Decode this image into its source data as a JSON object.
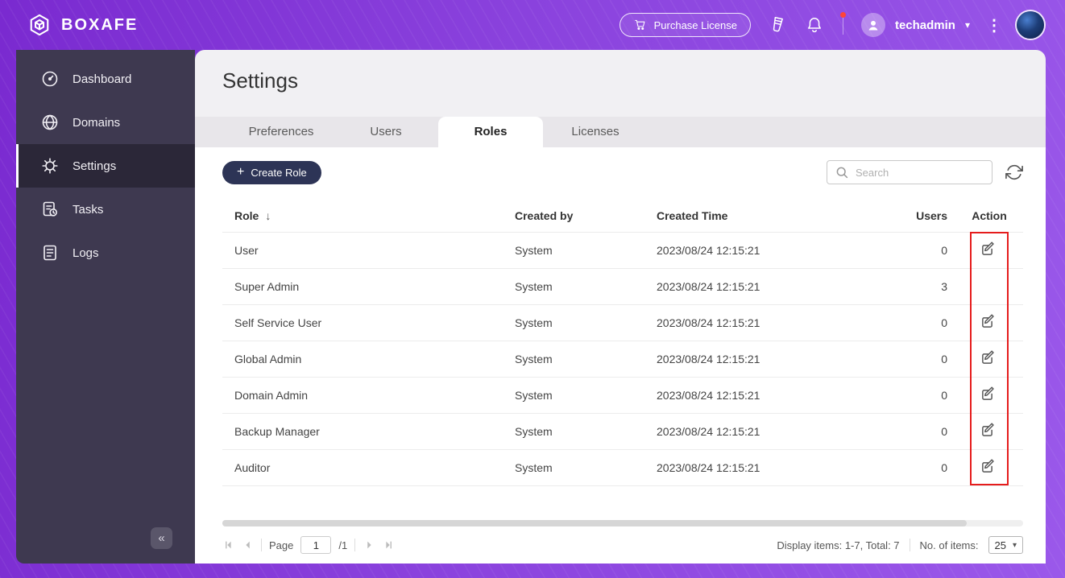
{
  "brand": {
    "name": "BOXAFE"
  },
  "topbar": {
    "purchase_license_label": "Purchase License",
    "username": "techadmin"
  },
  "sidebar": {
    "items": [
      {
        "label": "Dashboard"
      },
      {
        "label": "Domains"
      },
      {
        "label": "Settings"
      },
      {
        "label": "Tasks"
      },
      {
        "label": "Logs"
      }
    ]
  },
  "page": {
    "title": "Settings"
  },
  "tabs": [
    {
      "label": "Preferences"
    },
    {
      "label": "Users"
    },
    {
      "label": "Roles",
      "active": true
    },
    {
      "label": "Licenses"
    }
  ],
  "toolbar": {
    "create_role_label": "Create Role",
    "search_placeholder": "Search"
  },
  "table": {
    "columns": {
      "role": "Role",
      "created_by": "Created by",
      "created_time": "Created Time",
      "users": "Users",
      "action": "Action"
    },
    "rows": [
      {
        "role": "User",
        "created_by": "System",
        "created_time": "2023/08/24 12:15:21",
        "users": "0"
      },
      {
        "role": "Super Admin",
        "created_by": "System",
        "created_time": "2023/08/24 12:15:21",
        "users": "3"
      },
      {
        "role": "Self Service User",
        "created_by": "System",
        "created_time": "2023/08/24 12:15:21",
        "users": "0"
      },
      {
        "role": "Global Admin",
        "created_by": "System",
        "created_time": "2023/08/24 12:15:21",
        "users": "0"
      },
      {
        "role": "Domain Admin",
        "created_by": "System",
        "created_time": "2023/08/24 12:15:21",
        "users": "0"
      },
      {
        "role": "Backup Manager",
        "created_by": "System",
        "created_time": "2023/08/24 12:15:21",
        "users": "0"
      },
      {
        "role": "Auditor",
        "created_by": "System",
        "created_time": "2023/08/24 12:15:21",
        "users": "0"
      }
    ]
  },
  "pagination": {
    "page_label": "Page",
    "current_page": "1",
    "total_pages": "/1",
    "display_items": "Display items: 1-7, Total: 7",
    "items_per_page_label": "No. of items:",
    "items_per_page": "25"
  },
  "glyphs": {
    "caret_down": "▾",
    "kebab": "⋮",
    "collapse": "«",
    "sort_down": "↓",
    "plus": "+"
  },
  "colors": {
    "accent_purple": "#8a42dd",
    "sidebar_dark": "#3e3950",
    "sidebar_active": "#2b2738",
    "create_button": "#2d3456",
    "annotation_red": "#e51c1c",
    "notification_dot": "#ff4438"
  }
}
